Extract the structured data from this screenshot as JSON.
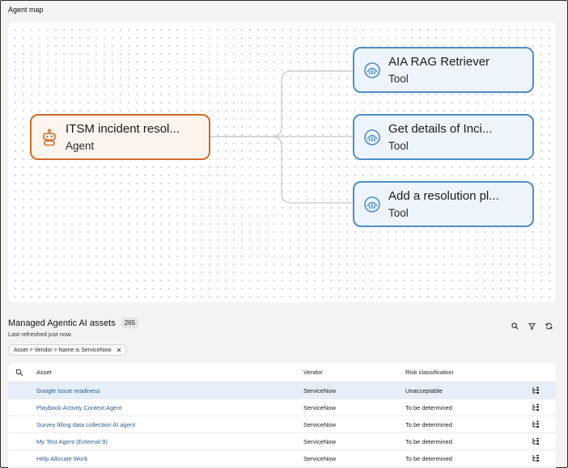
{
  "agent_map": {
    "title": "Agent map",
    "agent": {
      "name": "ITSM incident resol...",
      "type": "Agent",
      "icon": "robot-icon",
      "color": "#cf6b2a"
    },
    "tools": [
      {
        "name": "AIA RAG Retriever",
        "type": "Tool",
        "icon": "gauge-icon"
      },
      {
        "name": "Get details of Inci...",
        "type": "Tool",
        "icon": "gauge-icon"
      },
      {
        "name": "Add a resolution pl...",
        "type": "Tool",
        "icon": "gauge-icon"
      }
    ],
    "tool_color": "#4f8ec5"
  },
  "assets": {
    "title": "Managed Agentic AI assets",
    "count": "265",
    "refreshed": "Last refreshed just now.",
    "filter_chip": "Asset > Vendor > Name is ServiceNow",
    "filter_close": "✕",
    "columns": {
      "asset": "Asset",
      "vendor": "Vendor",
      "risk": "Risk classification"
    },
    "rows": [
      {
        "asset": "Google Issue readiness",
        "vendor": "ServiceNow",
        "risk": "Unacceptable"
      },
      {
        "asset": "Playbook Activity Context Agent",
        "vendor": "ServiceNow",
        "risk": "To be determined"
      },
      {
        "asset": "Survey filling data collection AI agent",
        "vendor": "ServiceNow",
        "risk": "To be determined"
      },
      {
        "asset": "My Test Agent (External 9)",
        "vendor": "ServiceNow",
        "risk": "To be determined"
      },
      {
        "asset": "Help Allocate Work",
        "vendor": "ServiceNow",
        "risk": "To be determined"
      }
    ],
    "selected_row_color": "#e5eef9"
  }
}
